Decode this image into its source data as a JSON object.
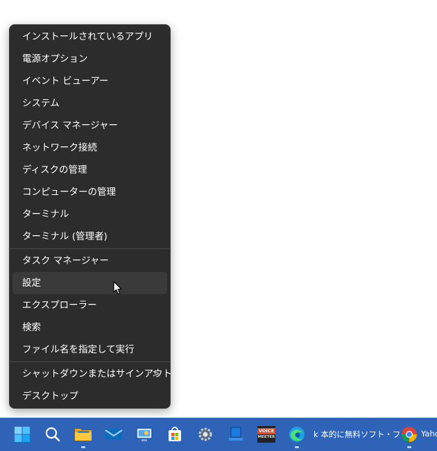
{
  "menu": {
    "group1": [
      "インストールされているアプリ",
      "電源オプション",
      "イベント ビューアー",
      "システム",
      "デバイス マネージャー",
      "ネットワーク接続",
      "ディスクの管理",
      "コンピューターの管理",
      "ターミナル",
      "ターミナル (管理者)"
    ],
    "group2": [
      "タスク マネージャー",
      "設定",
      "エクスプローラー",
      "検索",
      "ファイル名を指定して実行"
    ],
    "group3": [
      "シャットダウンまたはサインアウト",
      "デスクトップ"
    ],
    "chevron": ">"
  },
  "taskbar": {
    "edge_label": "k 本的に無料ソフト・フ",
    "chrome_label": "Yaho",
    "voicemeeter_top": "VOICE",
    "voicemeeter_bottom": "MEETER"
  }
}
